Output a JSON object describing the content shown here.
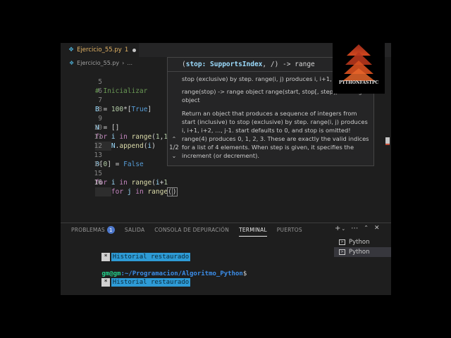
{
  "tab": {
    "filename": "Ejercicio_55.py",
    "problem_count": "1"
  },
  "breadcrumb": {
    "file": "Ejercicio_55.py",
    "more": "..."
  },
  "code_lines": [
    {
      "num": "5",
      "text": "# Inicializar"
    },
    {
      "num": "6",
      "text": ""
    },
    {
      "num": "7",
      "text": "B = 100*[True]"
    },
    {
      "num": "8",
      "text": ""
    },
    {
      "num": "9",
      "text": "N = []"
    },
    {
      "num": "10",
      "text": "for i in range(1,1"
    },
    {
      "num": "11",
      "text": "N.append(i)"
    },
    {
      "num": "12",
      "text": ""
    },
    {
      "num": "13",
      "text": "B[0] = False"
    },
    {
      "num": "14",
      "text": ""
    },
    {
      "num": "15",
      "text": "for i in range(i+1"
    },
    {
      "num": "16",
      "text": "for j in range()"
    }
  ],
  "hover": {
    "signature": "(stop: SupportsIndex, /) -> range",
    "signature_param": "stop: SupportsIndex",
    "line1": "stop (exclusive) by step. range(i, j) produces i, i+1, i+",
    "line2": "range(stop) -> range object range(start, stop[, step]) -> range object",
    "line3": "Return an object that produces a sequence of integers from start (inclusive) to stop (exclusive) by step. range(i, j) produces i, i+1, i+2, ..., j-1. start defaults to 0, and stop is omitted! range(4) produces 0, 1, 2, 3. These are exactly the valid indices for a list of 4 elements. When step is given, it specifies the increment (or decrement).",
    "overload": "1/2"
  },
  "panel": {
    "tabs": [
      "PROBLEMAS",
      "SALIDA",
      "CONSOLA DE DEPURACIÓN",
      "TERMINAL",
      "PUERTOS"
    ],
    "problems_badge": "1",
    "active_tab": "TERMINAL"
  },
  "terminal": {
    "restored_text": "Historial restaurado",
    "star": "*",
    "prompt_user": "gm@gm",
    "prompt_path": ":~/Programacion/Algoritmo_Python",
    "prompt_symbol": "$"
  },
  "terminal_list": [
    "Python",
    "Python"
  ],
  "logo": {
    "text": "PYTHONFASTPC"
  },
  "colors": {
    "accent": "#2e9bd6",
    "modified_file": "#e5b565",
    "prompt_user": "#23d18b",
    "prompt_path": "#3b8eea"
  }
}
